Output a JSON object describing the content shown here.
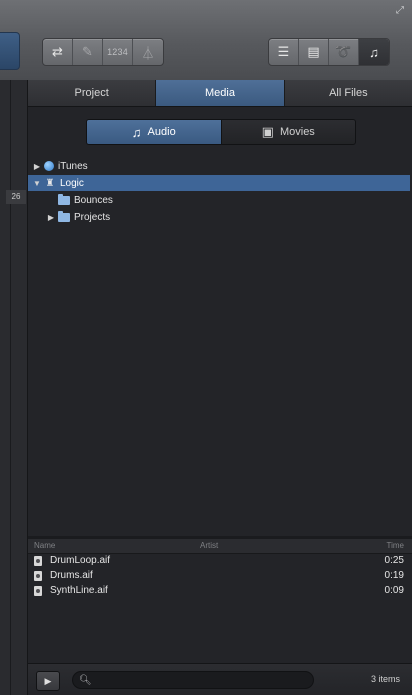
{
  "toolbar": {
    "count_in_label": "1234",
    "icons": [
      "cycle-icon",
      "pencil-icon",
      "count-in-icon",
      "metronome-icon",
      "list-editors-icon",
      "note-pad-icon",
      "loop-browser-icon",
      "media-browser-icon"
    ]
  },
  "left_pane": {
    "ruler_number": "26"
  },
  "tabs": [
    {
      "label": "Project",
      "selected": false
    },
    {
      "label": "Media",
      "selected": true
    },
    {
      "label": "All Files",
      "selected": false
    }
  ],
  "segment": {
    "audio_label": "Audio",
    "movies_label": "Movies"
  },
  "tree": [
    {
      "label": "iTunes",
      "expanded": false,
      "icon": "globe-icon",
      "level": 0,
      "selected": false
    },
    {
      "label": "Logic",
      "expanded": true,
      "icon": "logic-icon",
      "level": 0,
      "selected": true
    },
    {
      "label": "Bounces",
      "expanded": null,
      "icon": "folder-icon",
      "level": 1,
      "selected": false
    },
    {
      "label": "Projects",
      "expanded": false,
      "icon": "folder-icon",
      "level": 1,
      "selected": false
    }
  ],
  "list": {
    "columns": {
      "name": "Name",
      "artist": "Artist",
      "time": "Time"
    },
    "rows": [
      {
        "name": "DrumLoop.aif",
        "time": "0:25"
      },
      {
        "name": "Drums.aif",
        "time": "0:19"
      },
      {
        "name": "SynthLine.aif",
        "time": "0:09"
      }
    ]
  },
  "bottom": {
    "search_placeholder": "",
    "item_count": "3 items"
  }
}
